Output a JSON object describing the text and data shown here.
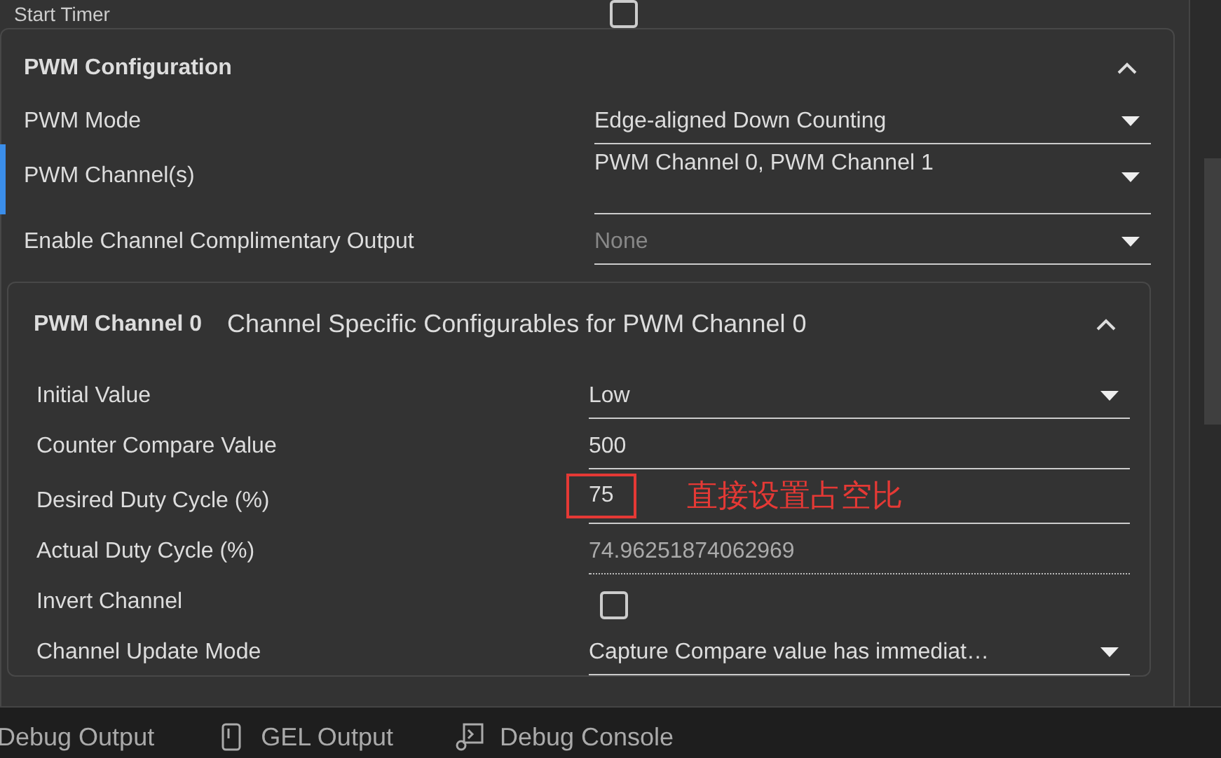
{
  "top_row": {
    "label": "Start Timer",
    "checked": false
  },
  "section": {
    "title": "PWM Configuration",
    "expanded": true,
    "fields": [
      {
        "label": "PWM Mode",
        "kind": "select",
        "value": "Edge-aligned Down Counting"
      },
      {
        "label": "PWM Channel(s)",
        "kind": "multiselect",
        "value": "PWM Channel 0, PWM Channel 1",
        "focused": true
      },
      {
        "label": "Enable Channel Complimentary Output",
        "kind": "select",
        "placeholder": "None"
      }
    ],
    "subsection": {
      "tag": "PWM Channel 0",
      "title": "Channel Specific Configurables for PWM Channel 0",
      "expanded": true,
      "fields": [
        {
          "label": "Initial Value",
          "kind": "select",
          "value": "Low"
        },
        {
          "label": "Counter Compare Value",
          "kind": "text",
          "value": "500"
        },
        {
          "label": "Desired Duty Cycle (%)",
          "kind": "text",
          "value": "75",
          "annotation": "直接设置占空比"
        },
        {
          "label": "Actual Duty Cycle (%)",
          "kind": "readonly",
          "value": "74.96251874062969"
        },
        {
          "label": "Invert Channel",
          "kind": "checkbox",
          "checked": false
        },
        {
          "label": "Channel Update Mode",
          "kind": "select",
          "value": "Capture Compare value has immediat…"
        }
      ]
    }
  },
  "bottom_tabs": [
    {
      "label": "Debug Output"
    },
    {
      "label": "GEL Output"
    },
    {
      "label": "Debug Console"
    }
  ]
}
